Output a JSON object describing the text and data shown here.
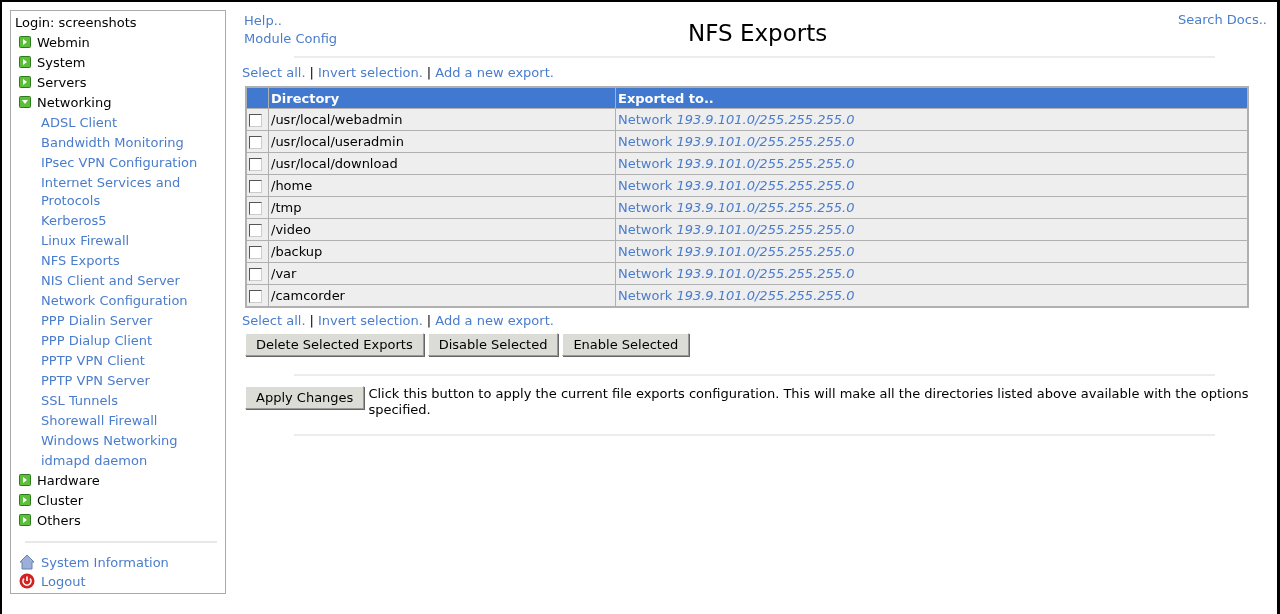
{
  "sidebar": {
    "login": "Login: screenshots",
    "categories": [
      {
        "label": "Webmin",
        "expanded": false
      },
      {
        "label": "System",
        "expanded": false
      },
      {
        "label": "Servers",
        "expanded": false
      },
      {
        "label": "Networking",
        "expanded": true,
        "children": [
          "ADSL Client",
          "Bandwidth Monitoring",
          "IPsec VPN Configuration",
          "Internet Services and Protocols",
          "Kerberos5",
          "Linux Firewall",
          "NFS Exports",
          "NIS Client and Server",
          "Network Configuration",
          "PPP Dialin Server",
          "PPP Dialup Client",
          "PPTP VPN Client",
          "PPTP VPN Server",
          "SSL Tunnels",
          "Shorewall Firewall",
          "Windows Networking",
          "idmapd daemon"
        ]
      },
      {
        "label": "Hardware",
        "expanded": false
      },
      {
        "label": "Cluster",
        "expanded": false
      },
      {
        "label": "Others",
        "expanded": false
      }
    ],
    "footer_links": [
      {
        "kind": "home",
        "label": "System Information"
      },
      {
        "kind": "logout",
        "label": "Logout"
      }
    ]
  },
  "header": {
    "links": [
      "Help..",
      "Module Config"
    ],
    "title": "NFS Exports",
    "search_docs": "Search Docs.."
  },
  "actions_top": {
    "links": [
      "Select all.",
      "Invert selection.",
      "Add a new export."
    ],
    "separator": "|"
  },
  "table": {
    "columns": [
      "Directory",
      "Exported to.."
    ],
    "rows": [
      {
        "checked": false,
        "directory": "/usr/local/webadmin",
        "exported_to": "Network *193.9.101.0/255.255.255.0*"
      },
      {
        "checked": false,
        "directory": "/usr/local/useradmin",
        "exported_to": "Network *193.9.101.0/255.255.255.0*"
      },
      {
        "checked": false,
        "directory": "/usr/local/download",
        "exported_to": "Network *193.9.101.0/255.255.255.0*"
      },
      {
        "checked": false,
        "directory": "/home",
        "exported_to": "Network *193.9.101.0/255.255.255.0*"
      },
      {
        "checked": false,
        "directory": "/tmp",
        "exported_to": "Network *193.9.101.0/255.255.255.0*"
      },
      {
        "checked": false,
        "directory": "/video",
        "exported_to": "Network *193.9.101.0/255.255.255.0*"
      },
      {
        "checked": false,
        "directory": "/backup",
        "exported_to": "Network *193.9.101.0/255.255.255.0*"
      },
      {
        "checked": false,
        "directory": "/var",
        "exported_to": "Network *193.9.101.0/255.255.255.0*"
      },
      {
        "checked": false,
        "directory": "/camcorder",
        "exported_to": "Network *193.9.101.0/255.255.255.0*"
      }
    ]
  },
  "actions_bottom": {
    "links": [
      "Select all.",
      "Invert selection.",
      "Add a new export."
    ],
    "separator": "|"
  },
  "buttons": [
    "Delete Selected Exports",
    "Disable Selected",
    "Enable Selected"
  ],
  "apply": {
    "button": "Apply Changes",
    "description": "Click this button to apply the current file exports configuration. This will make all the directories listed above available with the options specified."
  }
}
